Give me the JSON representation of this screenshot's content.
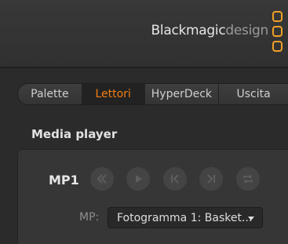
{
  "header": {
    "brand_part1": "Blackmagic",
    "brand_part2": "design",
    "logo_color": "#f0a028"
  },
  "tabs": [
    {
      "label": "Palette",
      "active": false
    },
    {
      "label": "Lettori",
      "active": true
    },
    {
      "label": "HyperDeck",
      "active": false
    },
    {
      "label": "Uscita",
      "active": false
    }
  ],
  "section": {
    "title": "Media player"
  },
  "player": {
    "name": "MP1",
    "controls": [
      "rewind-icon",
      "play-icon",
      "skip-to-start-icon",
      "skip-to-end-icon",
      "loop-icon"
    ],
    "select_label": "MP:",
    "select_value": "Fotogramma 1: Basket..."
  },
  "colors": {
    "accent": "#f07f10",
    "background": "#2b2b2b"
  }
}
